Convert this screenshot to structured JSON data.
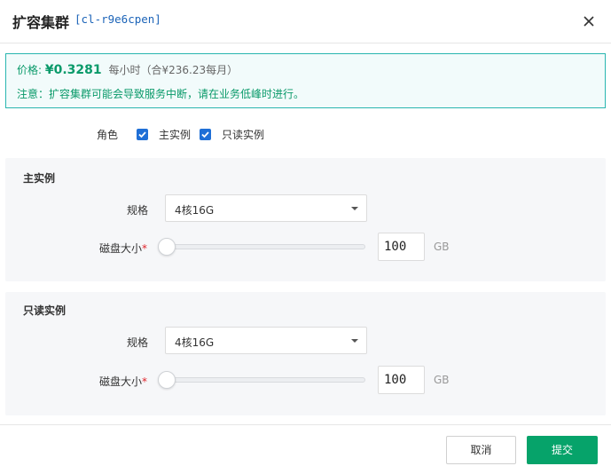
{
  "dialog": {
    "title": "扩容集群",
    "cluster_id": "[cl-r9e6cpen]"
  },
  "notice": {
    "price_label": "价格:",
    "price_value": "¥0.3281",
    "price_unit": "每小时（合¥236.23每月）",
    "note": "注意：扩容集群可能会导致服务中断，请在业务低峰时进行。"
  },
  "role": {
    "label": "角色",
    "options": [
      {
        "label": "主实例",
        "checked": true
      },
      {
        "label": "只读实例",
        "checked": true
      }
    ]
  },
  "primary": {
    "title": "主实例",
    "spec_label": "规格",
    "spec_value": "4核16G",
    "disk_label": "磁盘大小",
    "required_mark": "*",
    "disk_value": "100",
    "disk_unit": "GB",
    "slider_fraction": 0
  },
  "readonly": {
    "title": "只读实例",
    "spec_label": "规格",
    "spec_value": "4核16G",
    "disk_label": "磁盘大小",
    "required_mark": "*",
    "disk_value": "100",
    "disk_unit": "GB",
    "slider_fraction": 0
  },
  "footer": {
    "cancel_label": "取消",
    "submit_label": "提交"
  },
  "colors": {
    "accent_green": "#06a36a",
    "link_blue": "#1c64b8",
    "checkbox_blue": "#1f6fd6",
    "notice_border": "#29b6b0"
  }
}
